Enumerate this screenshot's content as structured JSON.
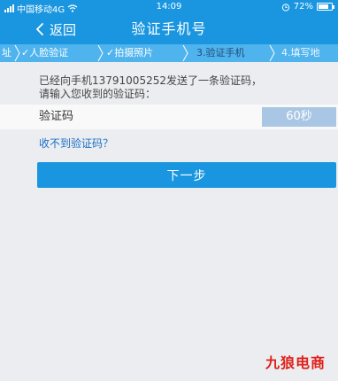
{
  "status_bar": {
    "carrier": "中国移动4G",
    "time": "14:09",
    "battery": "72%"
  },
  "nav": {
    "back_label": "返回",
    "title": "验证手机号"
  },
  "steps": [
    {
      "label": "址"
    },
    {
      "label": "✓人脸验证"
    },
    {
      "label": "✓拍摄照片"
    },
    {
      "label": "3.验证手机"
    },
    {
      "label": "4.填写地"
    }
  ],
  "info": {
    "line1": "已经向手机13791005252发送了一条验证码，",
    "line2": "请输入您收到的验证码："
  },
  "code": {
    "label": "验证码",
    "value": "",
    "placeholder": "",
    "countdown": "60秒"
  },
  "no_code_link": "收不到验证码？",
  "next_button": "下一步",
  "watermark": "九狼电商",
  "colors": {
    "primary": "#1a96e0",
    "step_bar": "#4fb3ee",
    "countdown_bg": "#a9c7e4",
    "link": "#1a6fc4",
    "watermark": "#e0201a"
  }
}
